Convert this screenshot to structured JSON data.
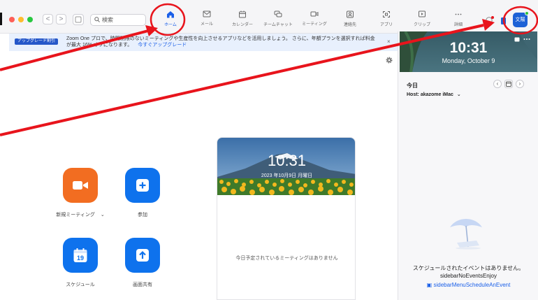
{
  "window": {
    "traffic_lights": [
      "#fe5f57",
      "#febc2e",
      "#28c840"
    ]
  },
  "toolbar": {
    "back_label": "<",
    "forward_label": ">",
    "search_placeholder": "検索"
  },
  "nav": [
    {
      "label": "ホーム",
      "icon": "home-icon",
      "active": true
    },
    {
      "label": "メール",
      "icon": "mail-icon"
    },
    {
      "label": "カレンダー",
      "icon": "calendar-icon"
    },
    {
      "label": "チームチャット",
      "icon": "chat-icon"
    },
    {
      "label": "ミーティング",
      "icon": "video-icon"
    },
    {
      "label": "連絡先",
      "icon": "contacts-icon"
    },
    {
      "label": "アプリ",
      "icon": "apps-icon"
    },
    {
      "label": "クリップ",
      "icon": "clips-icon"
    },
    {
      "label": "詳細",
      "icon": "more-icon"
    }
  ],
  "profile": {
    "avatar_text": "文陽",
    "status_color": "#2ec43b"
  },
  "banner": {
    "badge": "アップグレード割引",
    "text_line1": "Zoom One プロで、時間制限のないミーティングや生産性を向上させるアプリなどを活用しましょう。 さらに、年額プランを選択すれば料金",
    "text_line2": "が最大 16% オフになります。",
    "link": "今すぐアップグレード",
    "close": "×"
  },
  "actions": {
    "new_meeting": "新規ミーティング",
    "new_meeting_chevron": "⌄",
    "join": "参加",
    "schedule": "スケジュール",
    "schedule_day": "19",
    "share_screen": "画面共有",
    "orange": "#f26d21",
    "blue": "#0e72ed"
  },
  "card": {
    "time": "10:31",
    "date": "2023 年10月9日 月曜日",
    "empty": "今日予定されているミーティングはありません"
  },
  "sidebar": {
    "time": "10:31",
    "date": "Monday, October 9",
    "today": "今日",
    "host": "Host: akazome iMac",
    "host_chevron": "⌄",
    "prev": "‹",
    "next": "›",
    "empty_title": "スケジュールされたイベントはありません。",
    "empty_key": "sidebarNoEventsEnjoy",
    "schedule_link": "sidebarMenuScheduleAnEvent"
  },
  "annotations": {
    "color": "#e8141c"
  }
}
